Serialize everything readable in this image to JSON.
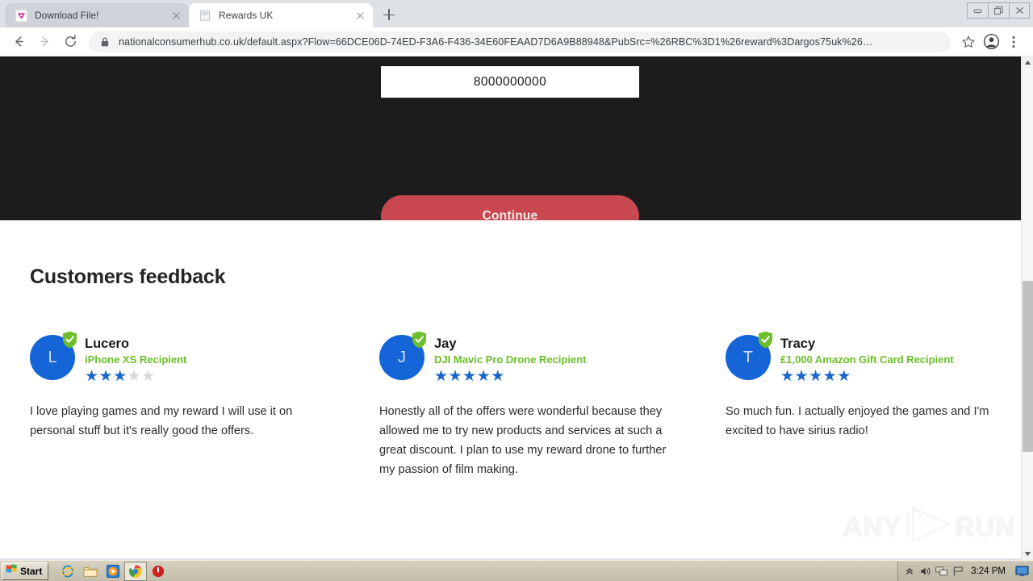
{
  "browser": {
    "tabs": [
      {
        "title": "Download File!",
        "favicon": "download-chevron-icon",
        "active": false
      },
      {
        "title": "Rewards UK",
        "favicon": "generic-page-icon",
        "active": true
      }
    ],
    "new_tab_label": "+",
    "nav": {
      "back": "back-arrow-icon",
      "forward": "forward-arrow-icon",
      "reload": "reload-icon"
    },
    "omnibox": {
      "lock": "lock-icon",
      "url": "nationalconsumerhub.co.uk/default.aspx?Flow=66DCE06D-74ED-F3A6-F436-34E60FEAAD7D6A9B88948&PubSrc=%26RBC%3D1%26reward%3Dargos75uk%26…"
    },
    "toolbar_icons": [
      "bookmark-star-icon",
      "profile-avatar-icon",
      "chrome-menu-icon"
    ],
    "window_buttons": [
      "minimize",
      "restore",
      "close"
    ]
  },
  "page": {
    "hero": {
      "phone_value": "8000000000",
      "phone_placeholder": "",
      "continue_label": "Continue",
      "background_color": "#1c1c1c",
      "button_color": "#c9474f"
    },
    "feedback": {
      "heading": "Customers feedback",
      "star_on_color": "#1a66c9",
      "star_off_color": "#d5d9dd",
      "award_color": "#6cbf2a",
      "avatar_color": "#1565d8",
      "testimonials": [
        {
          "initial": "L",
          "name": "Lucero",
          "award": "iPhone XS Recipient",
          "rating": 3,
          "max_rating": 5,
          "text": "I love playing games and my reward I will use it on personal stuff but it's really good the offers."
        },
        {
          "initial": "J",
          "name": "Jay",
          "award": "DJI Mavic Pro Drone Recipient",
          "rating": 5,
          "max_rating": 5,
          "text": "Honestly all of the offers were wonderful because they allowed me to try new products and services at such a great discount. I plan to use my reward drone to further my passion of film making."
        },
        {
          "initial": "T",
          "name": "Tracy",
          "award": "£1,000 Amazon Gift Card Recipient",
          "rating": 5,
          "max_rating": 5,
          "text": "So much fun. I actually enjoyed the games and I'm excited to have sirius radio!"
        }
      ]
    },
    "watermark": {
      "left": "ANY",
      "right": "RUN",
      "logo": "play-triangle-icon"
    }
  },
  "taskbar": {
    "start_label": "Start",
    "quick_launch": [
      {
        "name": "internet-explorer-icon",
        "active": false
      },
      {
        "name": "file-explorer-icon",
        "active": false
      },
      {
        "name": "media-player-icon",
        "active": false
      },
      {
        "name": "google-chrome-icon",
        "active": true
      },
      {
        "name": "shutdown-red-icon",
        "active": false
      }
    ],
    "tray_icons": [
      "chevron-up-icon",
      "volume-icon",
      "network-icon",
      "flag-icon"
    ],
    "clock": "3:24 PM",
    "show-desktop": "show-desktop-icon"
  }
}
